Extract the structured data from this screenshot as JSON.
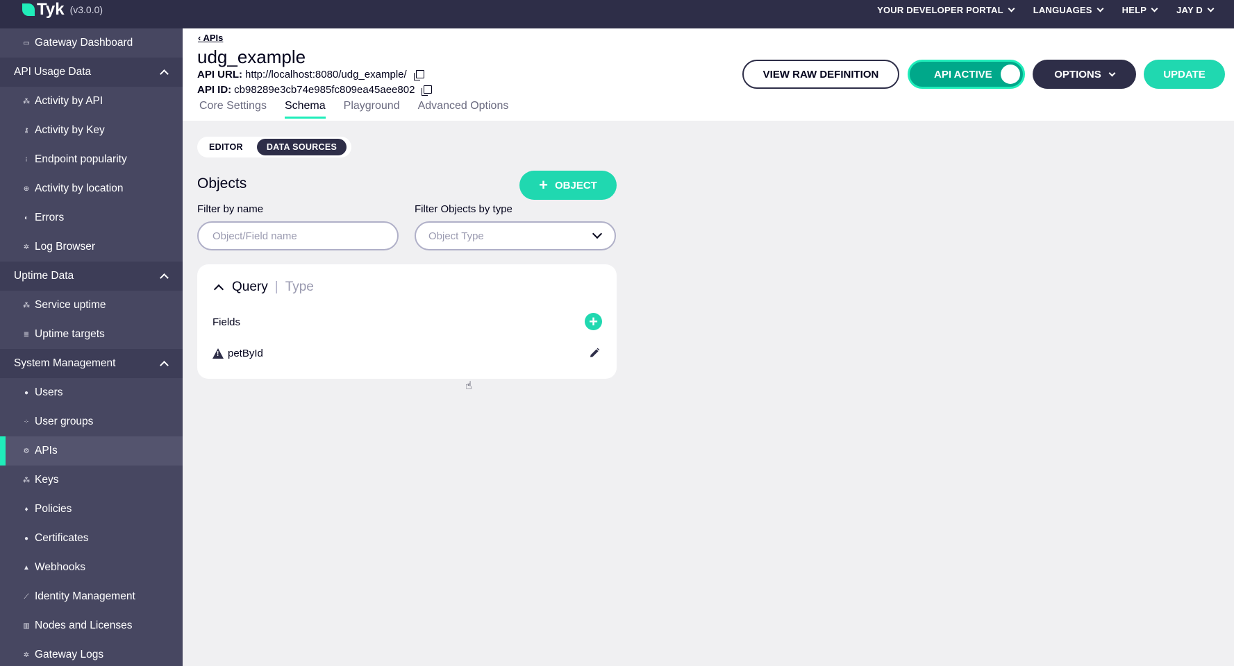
{
  "topbar": {
    "brand": "Tyk",
    "version": "(v3.0.0)",
    "nav": [
      "YOUR DEVELOPER PORTAL",
      "LANGUAGES",
      "HELP",
      "JAY D"
    ]
  },
  "sidebar": {
    "items": [
      {
        "kind": "item",
        "label": "Gateway Dashboard",
        "icon": "monitor-icon",
        "glyph": "▭"
      },
      {
        "kind": "section",
        "label": "API Usage Data"
      },
      {
        "kind": "item",
        "label": "Activity by API",
        "icon": "activity-api-icon",
        "glyph": "⁂"
      },
      {
        "kind": "item",
        "label": "Activity by Key",
        "icon": "key-icon",
        "glyph": "⚷"
      },
      {
        "kind": "item",
        "label": "Endpoint popularity",
        "icon": "endpoint-icon",
        "glyph": "⁝"
      },
      {
        "kind": "item",
        "label": "Activity by location",
        "icon": "globe-icon",
        "glyph": "⊕"
      },
      {
        "kind": "item",
        "label": "Errors",
        "icon": "error-icon",
        "glyph": "◐"
      },
      {
        "kind": "item",
        "label": "Log Browser",
        "icon": "log-icon",
        "glyph": "✲"
      },
      {
        "kind": "section",
        "label": "Uptime Data"
      },
      {
        "kind": "item",
        "label": "Service uptime",
        "icon": "uptime-icon",
        "glyph": "⁂"
      },
      {
        "kind": "item",
        "label": "Uptime targets",
        "icon": "list-icon",
        "glyph": "≣"
      },
      {
        "kind": "section",
        "label": "System Management"
      },
      {
        "kind": "item",
        "label": "Users",
        "icon": "user-icon",
        "glyph": "●"
      },
      {
        "kind": "item",
        "label": "User groups",
        "icon": "users-icon",
        "glyph": "⁘"
      },
      {
        "kind": "item",
        "label": "APIs",
        "icon": "apis-icon",
        "glyph": "⚙",
        "active": true
      },
      {
        "kind": "item",
        "label": "Keys",
        "icon": "keys-icon",
        "glyph": "⁂"
      },
      {
        "kind": "item",
        "label": "Policies",
        "icon": "policy-icon",
        "glyph": "♦"
      },
      {
        "kind": "item",
        "label": "Certificates",
        "icon": "certificate-icon",
        "glyph": "●"
      },
      {
        "kind": "item",
        "label": "Webhooks",
        "icon": "bell-icon",
        "glyph": "▲"
      },
      {
        "kind": "item",
        "label": "Identity Management",
        "icon": "identity-icon",
        "glyph": "⟋"
      },
      {
        "kind": "item",
        "label": "Nodes and Licenses",
        "icon": "nodes-icon",
        "glyph": "▥"
      },
      {
        "kind": "item",
        "label": "Gateway Logs",
        "icon": "gateway-logs-icon",
        "glyph": "✲"
      }
    ]
  },
  "header": {
    "back_label": "APIs",
    "api_name": "udg_example",
    "api_url_label": "API URL:",
    "api_url": "http://localhost:8080/udg_example/",
    "api_id_label": "API ID:",
    "api_id": "cb98289e3cb74e985fc809ea45aee802",
    "tabs": [
      "Core Settings",
      "Schema",
      "Playground",
      "Advanced Options"
    ],
    "active_tab": "Schema",
    "buttons": {
      "raw": "VIEW RAW DEFINITION",
      "active": "API ACTIVE",
      "options": "OPTIONS",
      "update": "UPDATE"
    }
  },
  "schema": {
    "segments": [
      "EDITOR",
      "DATA SOURCES"
    ],
    "active_segment": "DATA SOURCES",
    "objects_title": "Objects",
    "add_object_label": "OBJECT",
    "filter_name_label": "Filter by name",
    "filter_name_placeholder": "Object/Field name",
    "filter_type_label": "Filter Objects by type",
    "filter_type_placeholder": "Object Type",
    "card": {
      "name": "Query",
      "type": "Type",
      "fields_label": "Fields",
      "fields": [
        "petById"
      ]
    }
  },
  "colors": {
    "accent": "#20edba",
    "dark": "#2e2e48",
    "sidebar": "#3d3d57"
  }
}
